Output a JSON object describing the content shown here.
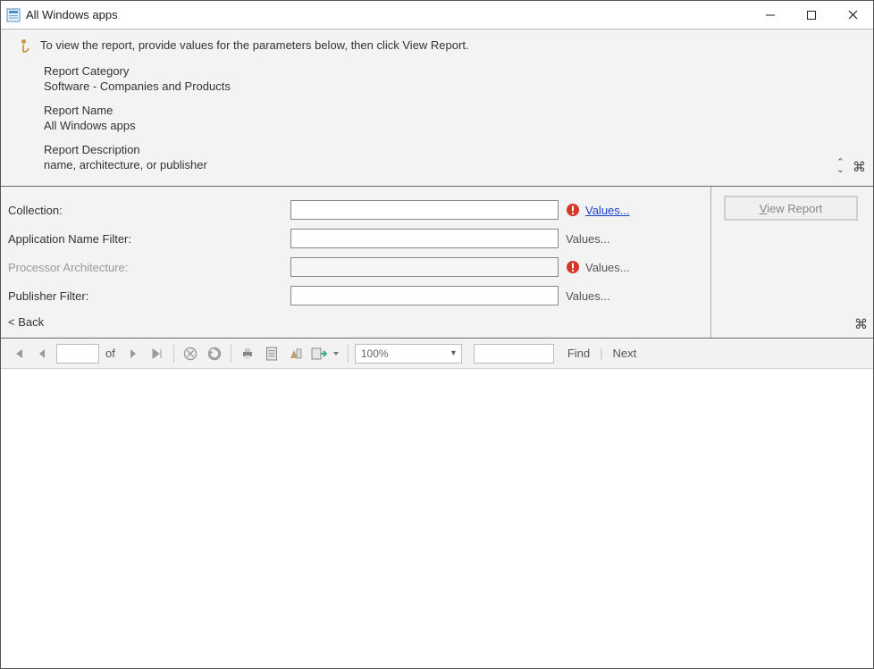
{
  "window": {
    "title": "All Windows apps"
  },
  "info": {
    "instruction": "To view the report, provide values for the parameters below, then click View Report.",
    "category_label": "Report Category",
    "category_value": "Software - Companies and Products",
    "name_label": "Report Name",
    "name_value": "All Windows apps",
    "desc_label": "Report Description",
    "desc_value": "name, architecture, or publisher"
  },
  "params": {
    "rows": [
      {
        "label": "Collection:",
        "disabled": false,
        "value": "",
        "warn": true,
        "linkStyle": "link",
        "linkText": "Values..."
      },
      {
        "label": "Application Name Filter:",
        "disabled": false,
        "value": "",
        "warn": false,
        "linkStyle": "plain",
        "linkText": "Values..."
      },
      {
        "label": "Processor Architecture:",
        "disabled": true,
        "value": "",
        "warn": true,
        "linkStyle": "plain",
        "linkText": "Values..."
      },
      {
        "label": "Publisher Filter:",
        "disabled": false,
        "value": "",
        "warn": false,
        "linkStyle": "plain",
        "linkText": "Values..."
      }
    ],
    "back": "< Back",
    "viewReport": "View Report"
  },
  "toolbar": {
    "of": "of",
    "pageValue": "",
    "zoom": "100%",
    "findPlaceholder": "",
    "findLabel": "Find",
    "nextLabel": "Next"
  }
}
